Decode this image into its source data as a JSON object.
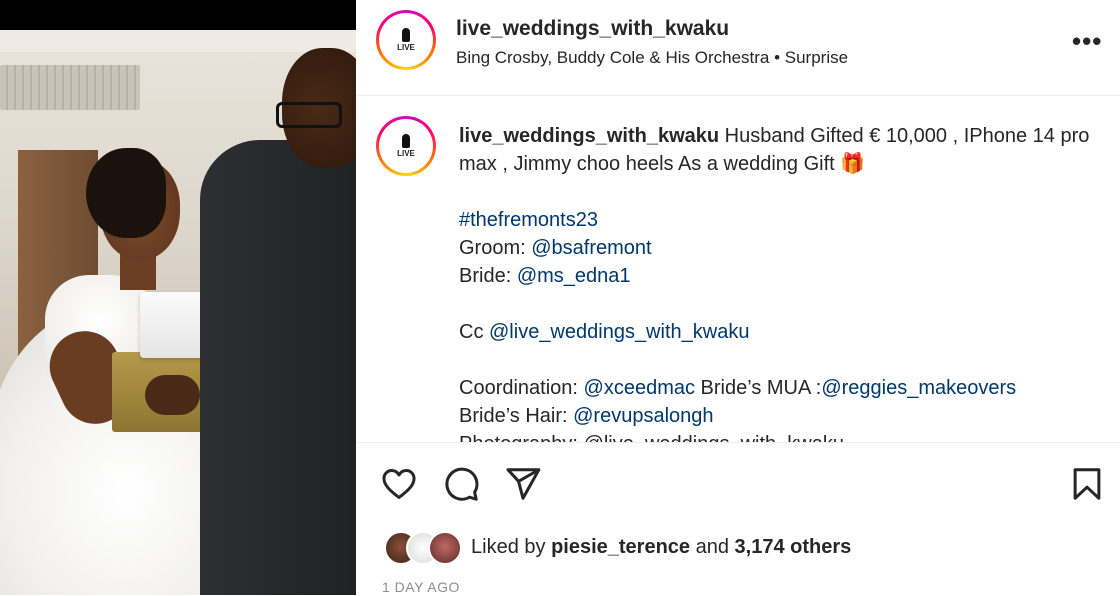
{
  "post": {
    "username": "live_weddings_with_kwaku",
    "audio": "Bing Crosby, Buddy Cole & His Orchestra • Surprise",
    "avatar_text": "LIVE",
    "more_label": "•••"
  },
  "caption": {
    "username": "live_weddings_with_kwaku",
    "text": "Husband Gifted € 10,000 , IPhone 14 pro max , Jimmy choo heels As a wedding Gift 🎁",
    "hashtag": "#thefremonts23",
    "groom_label": "Groom: ",
    "groom_handle": "@bsafremont",
    "bride_label": "Bride: ",
    "bride_handle": "@ms_edna1",
    "cc_label": "Cc ",
    "cc_handle": "@live_weddings_with_kwaku",
    "coordination_label": "Coordination: ",
    "coordination_handle": "@xceedmac",
    "mua_label": " Bride’s MUA :",
    "mua_handle": "@reggies_makeovers",
    "hair_label": "Bride’s Hair: ",
    "hair_handle": "@revupsalongh",
    "cut_line": "Photography: @live_weddings_with_kwaku"
  },
  "actions": {
    "like_icon": "heart-icon",
    "comment_icon": "comment-icon",
    "share_icon": "paper-plane-icon",
    "save_icon": "bookmark-icon"
  },
  "likes": {
    "prefix": "Liked by ",
    "user": "piesie_terence",
    "middle": " and ",
    "count": "3,174 others"
  },
  "timestamp": "1 DAY AGO",
  "colors": {
    "link": "#00376b",
    "text": "#262626",
    "muted": "#8e8e8e"
  }
}
